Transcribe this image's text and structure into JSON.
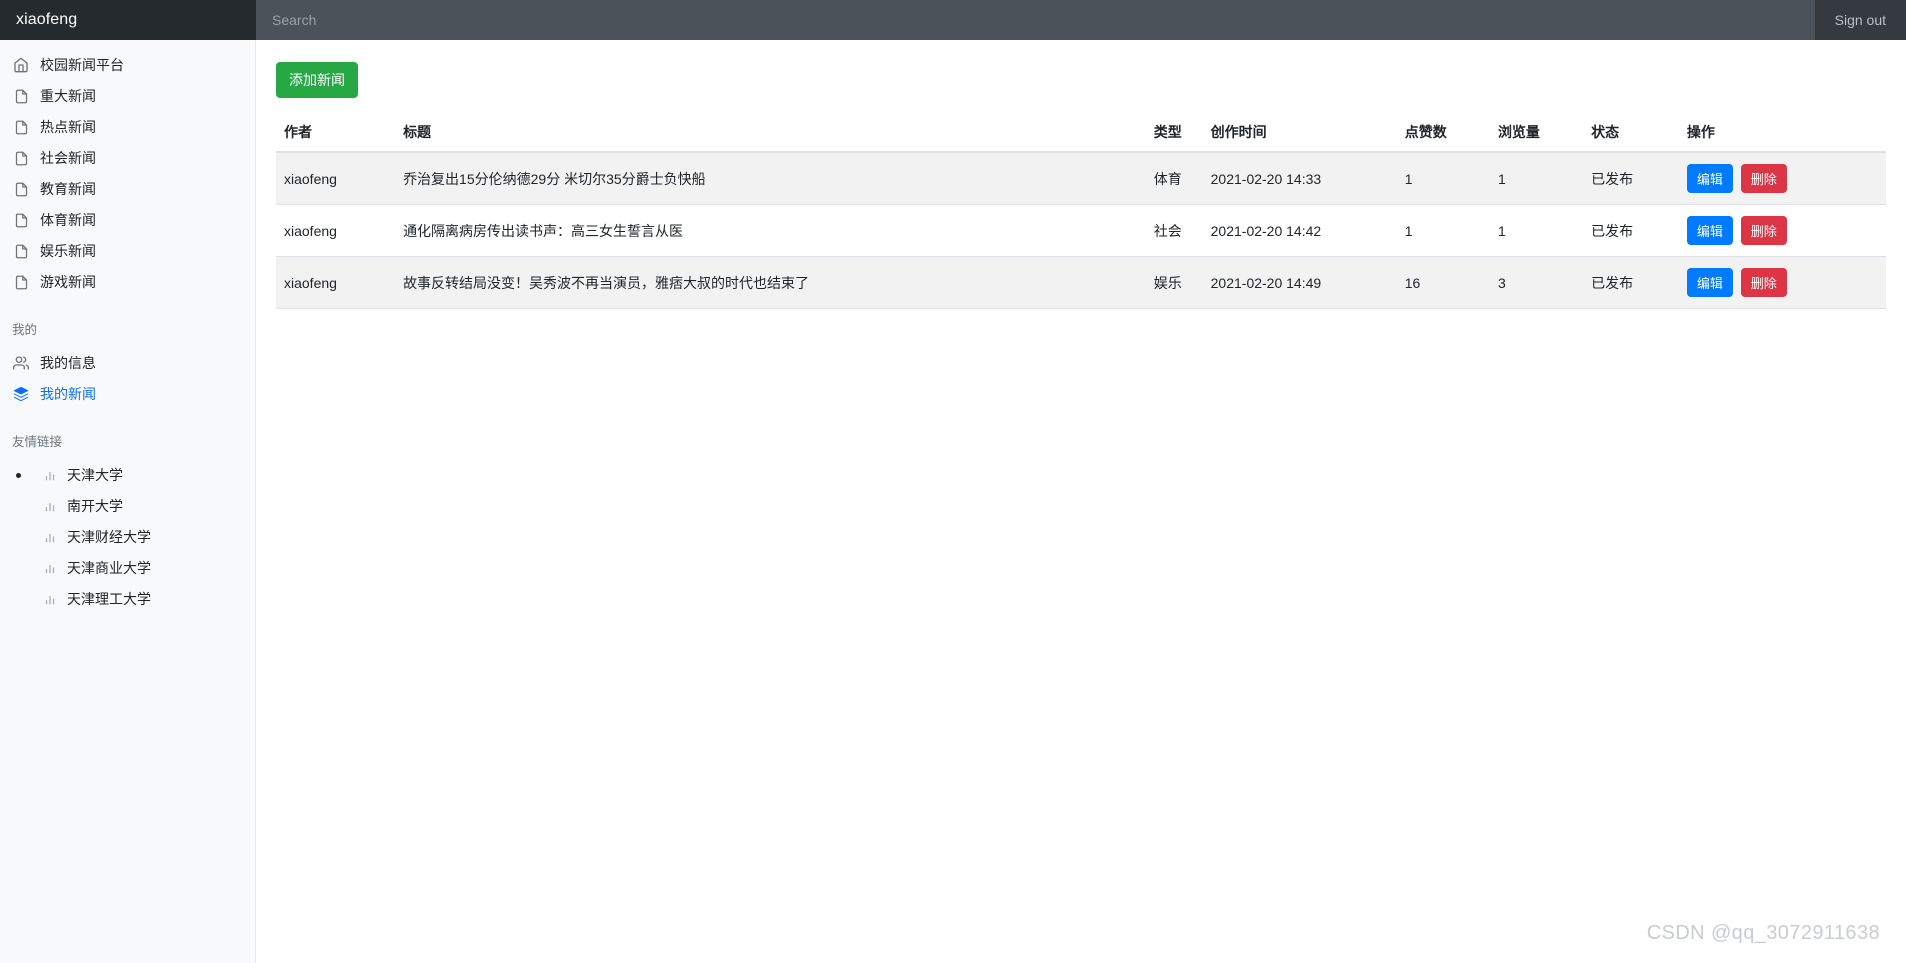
{
  "navbar": {
    "brand": "xiaofeng",
    "search_placeholder": "Search",
    "search_value": "",
    "signout_label": "Sign out"
  },
  "sidebar": {
    "items": [
      {
        "label": "校园新闻平台",
        "icon": "home-icon",
        "active": false
      },
      {
        "label": "重大新闻",
        "icon": "file-icon",
        "active": false
      },
      {
        "label": "热点新闻",
        "icon": "file-icon",
        "active": false
      },
      {
        "label": "社会新闻",
        "icon": "file-icon",
        "active": false
      },
      {
        "label": "教育新闻",
        "icon": "file-icon",
        "active": false
      },
      {
        "label": "体育新闻",
        "icon": "file-icon",
        "active": false
      },
      {
        "label": "娱乐新闻",
        "icon": "file-icon",
        "active": false
      },
      {
        "label": "游戏新闻",
        "icon": "file-icon",
        "active": false
      }
    ],
    "my_section_label": "我的",
    "my_items": [
      {
        "label": "我的信息",
        "icon": "users-icon",
        "active": false
      },
      {
        "label": "我的新闻",
        "icon": "layers-icon",
        "active": true
      }
    ],
    "links_section_label": "友情链接",
    "links": [
      {
        "label": "天津大学",
        "icon": "bar-chart-icon",
        "bulleted": true
      },
      {
        "label": "南开大学",
        "icon": "bar-chart-icon",
        "bulleted": false
      },
      {
        "label": "天津财经大学",
        "icon": "bar-chart-icon",
        "bulleted": false
      },
      {
        "label": "天津商业大学",
        "icon": "bar-chart-icon",
        "bulleted": false
      },
      {
        "label": "天津理工大学",
        "icon": "bar-chart-icon",
        "bulleted": false
      }
    ]
  },
  "main": {
    "add_button_label": "添加新闻",
    "table": {
      "columns": [
        "作者",
        "标题",
        "类型",
        "创作时间",
        "点赞数",
        "浏览量",
        "状态",
        "操作"
      ],
      "rows": [
        {
          "author": "xiaofeng",
          "title": "乔治复出15分伦纳德29分 米切尔35分爵士负快船",
          "type": "体育",
          "created_at": "2021-02-20 14:33",
          "likes": "1",
          "views": "1",
          "status": "已发布",
          "edit_label": "编辑",
          "delete_label": "删除"
        },
        {
          "author": "xiaofeng",
          "title": "通化隔离病房传出读书声：高三女生誓言从医",
          "type": "社会",
          "created_at": "2021-02-20 14:42",
          "likes": "1",
          "views": "1",
          "status": "已发布",
          "edit_label": "编辑",
          "delete_label": "删除"
        },
        {
          "author": "xiaofeng",
          "title": "故事反转结局没变！吴秀波不再当演员，雅痞大叔的时代也结束了",
          "type": "娱乐",
          "created_at": "2021-02-20 14:49",
          "likes": "16",
          "views": "3",
          "status": "已发布",
          "edit_label": "编辑",
          "delete_label": "删除"
        }
      ]
    }
  },
  "watermark": "CSDN @qq_3072911638",
  "colors": {
    "navbar_bg": "#343a40",
    "brand_bg": "#242a2e",
    "search_bg": "#4b5259",
    "sidebar_bg": "#f8f9fa",
    "accent_blue": "#0d6efd",
    "add_green": "#28a745",
    "edit_blue": "#007bff",
    "delete_red": "#dc3545",
    "row_stripe": "#f2f2f2"
  }
}
